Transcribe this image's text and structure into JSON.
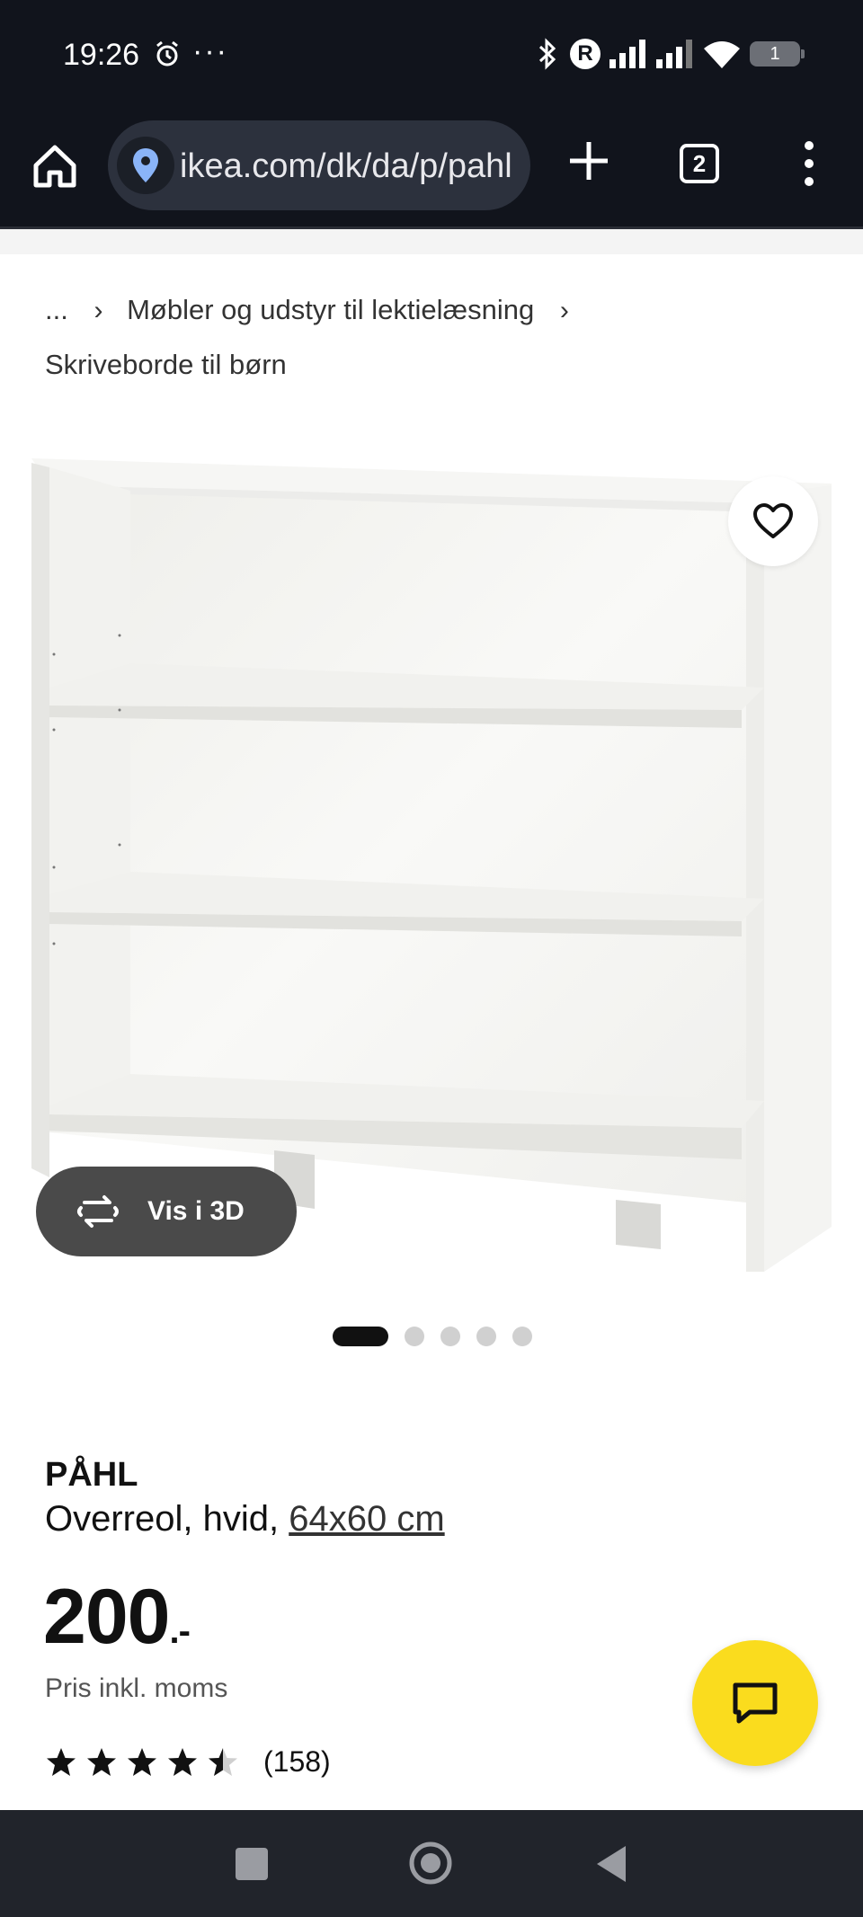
{
  "status_bar": {
    "time": "19:26",
    "dots": "···",
    "battery": "1"
  },
  "browser": {
    "url": "ikea.com/dk/da/p/pahl",
    "tab_count": "2"
  },
  "breadcrumb": {
    "ellipsis": "...",
    "level1": "Møbler og udstyr til lektielæsning",
    "level2": "Skriveborde til børn"
  },
  "product": {
    "view_3d_label": "Vis i 3D",
    "carousel": {
      "total": 5,
      "active": 1
    },
    "brand": "PÅHL",
    "description": "Overreol, hvid,",
    "size_link": "64x60 cm",
    "price": "200",
    "price_suffix": ".-",
    "price_note": "Pris inkl. moms",
    "rating": 4.5,
    "review_count": "(158)"
  },
  "colors": {
    "accent_yellow": "#fadc1e",
    "dark_bar": "#11141c"
  },
  "icons": [
    "home-icon",
    "location-icon",
    "plus-icon",
    "tabs-icon",
    "menu-icon",
    "heart-icon",
    "rotate-3d-icon",
    "star-icon",
    "chat-icon"
  ]
}
